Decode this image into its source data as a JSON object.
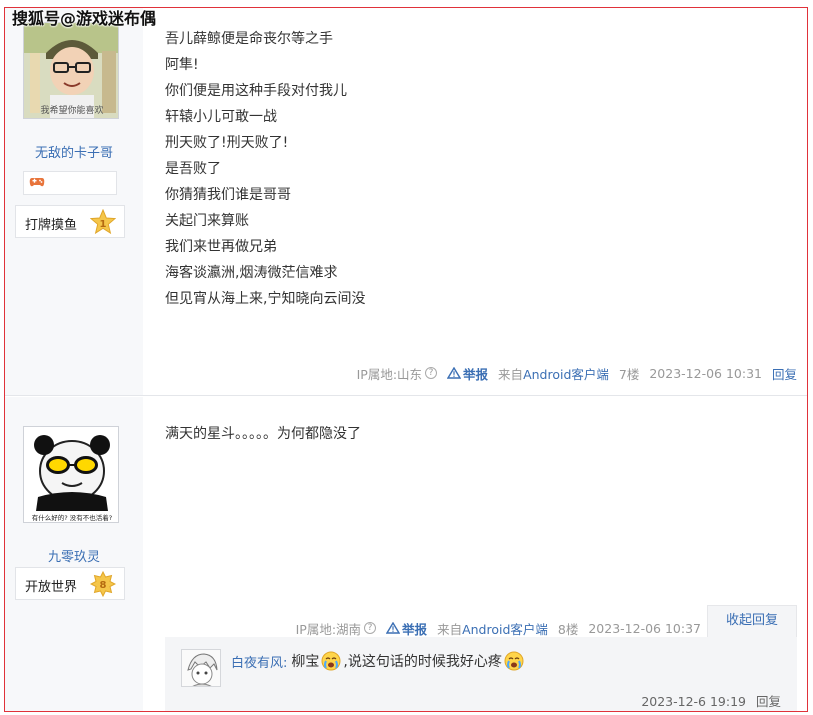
{
  "watermark": "搜狐号@游戏迷布偶",
  "post1": {
    "avatar_caption": "我希望你能喜欢",
    "username": "无敌的卡子哥",
    "level_name": "打牌摸鱼",
    "level_num": "1",
    "lines": [
      "吾儿薛鲸便是命丧尔等之手",
      "阿隼!",
      "你们便是用这种手段对付我儿",
      "轩辕小儿可敢一战",
      "刑天败了!刑天败了!",
      "是吾败了",
      "你猜猜我们谁是哥哥",
      "关起门来算账",
      "我们来世再做兄弟",
      "海客谈瀛洲,烟涛微茫信难求",
      "但见宵从海上来,宁知晓向云间没"
    ],
    "tail": {
      "ip": "IP属地:山东",
      "report": "举报",
      "from_prefix": "来自",
      "client": "Android客户端",
      "floor": "7楼",
      "time": "2023-12-06 10:31",
      "reply": "回复"
    }
  },
  "post2": {
    "avatar_caption": "有什么好的? 没有不也活着?",
    "username": "九零玖灵",
    "level_name": "开放世界",
    "level_num": "8",
    "lines": [
      "满天的星斗。。。。。为何都隐没了"
    ],
    "tail": {
      "ip": "IP属地:湖南",
      "report": "举报",
      "from_prefix": "来自",
      "client": "Android客户端",
      "floor": "8楼",
      "time": "2023-12-06 10:37"
    },
    "collapse": "收起回复",
    "reply": {
      "user": "白夜有风:",
      "text1": "柳宝",
      "text2": ",说这句话的时候我好心疼",
      "time": "2023-12-6 19:19",
      "reply": "回复"
    }
  },
  "colors": {
    "link": "#3b6fb4",
    "sidebar_bg": "#f7f8fa",
    "frame": "#e0323a",
    "star": "#f5c64a"
  }
}
